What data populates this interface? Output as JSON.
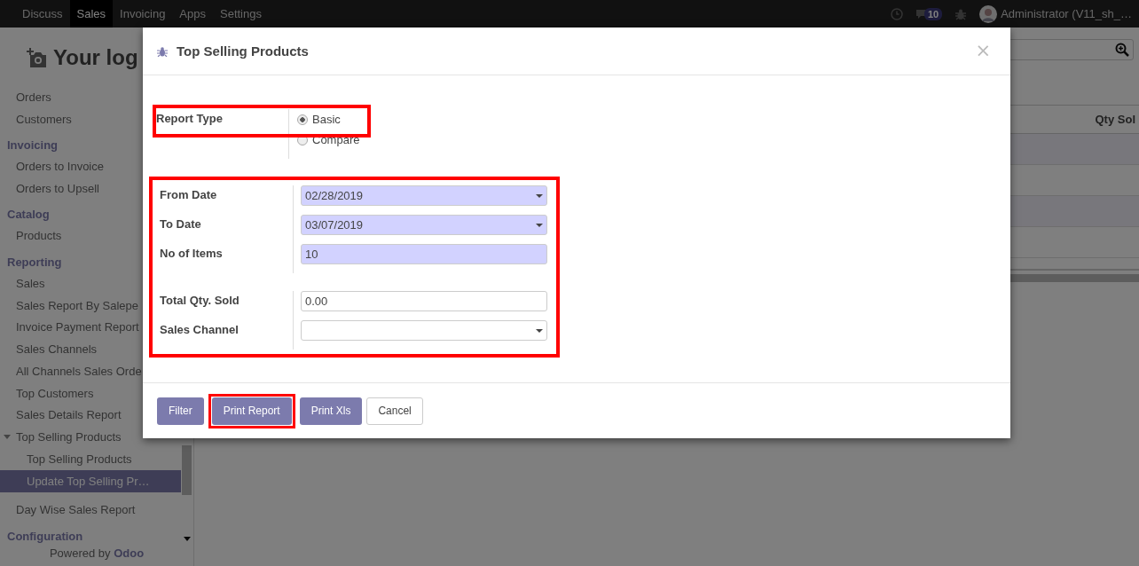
{
  "navbar": {
    "apps": [
      {
        "label": "Discuss",
        "selected": false
      },
      {
        "label": "Sales",
        "selected": true
      },
      {
        "label": "Invoicing",
        "selected": false
      },
      {
        "label": "Apps",
        "selected": false
      },
      {
        "label": "Settings",
        "selected": false
      }
    ],
    "chat_count": "10",
    "user": "Administrator (V11_sh_…"
  },
  "sidebar": {
    "logo": "Your log",
    "menu": [
      {
        "kind": "item",
        "label": "Orders",
        "selected": false
      },
      {
        "kind": "item",
        "label": "Customers",
        "selected": false
      },
      {
        "kind": "heading",
        "label": "Invoicing"
      },
      {
        "kind": "item",
        "label": "Orders to Invoice",
        "selected": false
      },
      {
        "kind": "item",
        "label": "Orders to Upsell",
        "selected": false
      },
      {
        "kind": "heading",
        "label": "Catalog"
      },
      {
        "kind": "item",
        "label": "Products",
        "selected": false
      },
      {
        "kind": "heading",
        "label": "Reporting"
      },
      {
        "kind": "item",
        "label": "Sales",
        "selected": false
      },
      {
        "kind": "item",
        "label": "Sales Report By Salepe",
        "selected": false
      },
      {
        "kind": "item",
        "label": "Invoice Payment Report",
        "selected": false
      },
      {
        "kind": "item",
        "label": "Sales Channels",
        "selected": false
      },
      {
        "kind": "item",
        "label": "All Channels Sales Orde",
        "selected": false
      },
      {
        "kind": "item",
        "label": "Top Customers",
        "selected": false
      },
      {
        "kind": "item",
        "label": "Sales Details Report",
        "selected": false
      },
      {
        "kind": "item",
        "label": "Top Selling Products",
        "selected": false,
        "expanded": true,
        "children": [
          {
            "label": "Top Selling Products",
            "selected": false
          },
          {
            "label": "Update Top Selling Pr…",
            "selected": true
          }
        ]
      },
      {
        "kind": "item",
        "label": "Day Wise Sales Report",
        "selected": false
      },
      {
        "kind": "heading",
        "label": "Configuration"
      }
    ],
    "footer": {
      "text": "Powered by",
      "brand": "Odoo"
    }
  },
  "table": {
    "columns": [
      "Qty Sol"
    ]
  },
  "dialog": {
    "title": "Top Selling Products",
    "close_label": "×",
    "report_type": {
      "label": "Report Type",
      "highlighted": true,
      "options": [
        {
          "label": "Basic",
          "selected": true
        },
        {
          "label": "Compare",
          "selected": false
        }
      ]
    },
    "fields_highlighted": true,
    "field_groups": [
      {
        "fields": [
          {
            "label": "From Date",
            "kind": "date",
            "value": "02/28/2019",
            "required": true
          },
          {
            "label": "To Date",
            "kind": "date",
            "value": "03/07/2019",
            "required": true
          },
          {
            "label": "No of Items",
            "kind": "text",
            "value": "10",
            "required": true
          }
        ]
      },
      {
        "fields": [
          {
            "label": "Total Qty. Sold",
            "kind": "text",
            "value": "0.00",
            "required": false
          },
          {
            "label": "Sales Channel",
            "kind": "select",
            "required": false
          }
        ]
      }
    ],
    "buttons": [
      {
        "label": "Filter",
        "kind": "primary",
        "highlighted": false
      },
      {
        "label": "Print Report",
        "kind": "primary",
        "highlighted": true
      },
      {
        "label": "Print Xls",
        "kind": "primary",
        "highlighted": false
      },
      {
        "label": "Cancel",
        "kind": "secondary",
        "highlighted": false
      }
    ]
  }
}
